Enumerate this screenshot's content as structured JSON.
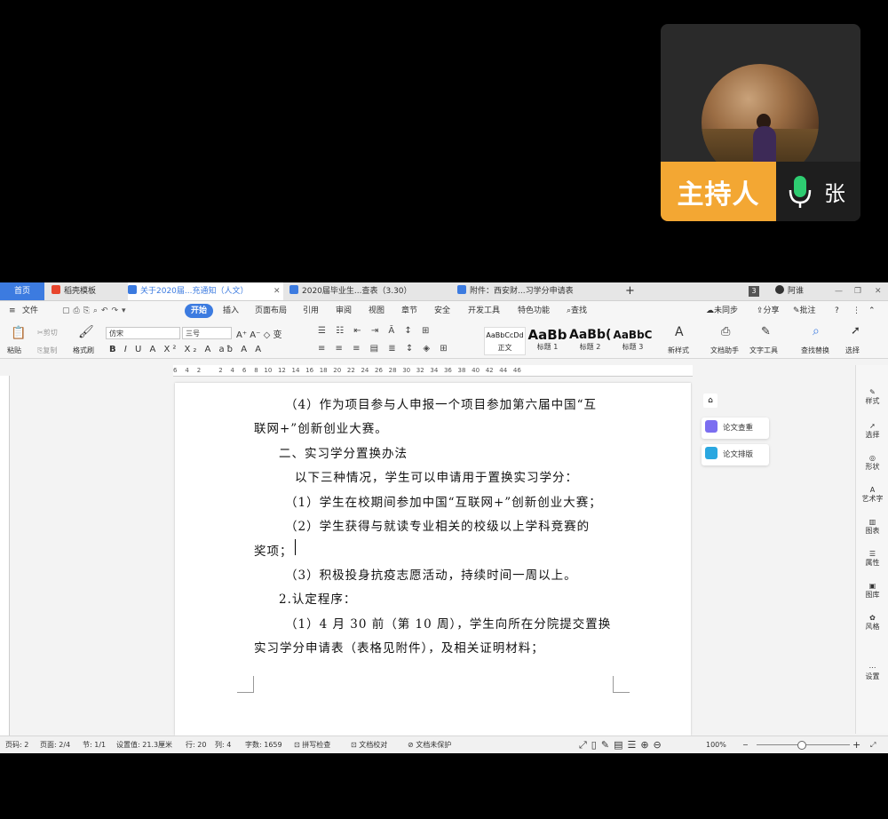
{
  "video": {
    "host_badge": "主持人",
    "participant_name": "张"
  },
  "tabs": {
    "home": "首页",
    "template": "稻壳模板",
    "doc1": "关于2020届...充通知（人文）",
    "doc2": "2020届毕业生...查表（3.30）",
    "doc3": "附件：西安财...习学分申请表",
    "add": "+",
    "page_count": "3",
    "user": "阿谁"
  },
  "menu": {
    "file": "文件",
    "items": [
      "开始",
      "插入",
      "页面布局",
      "引用",
      "审阅",
      "视图",
      "章节",
      "安全",
      "开发工具",
      "特色功能"
    ],
    "search": "查找",
    "sync": "未同步",
    "share": "分享",
    "comment": "批注"
  },
  "ribbon": {
    "paste": "粘贴",
    "cut": "剪切",
    "copy": "复制",
    "format_painter": "格式刷",
    "font_name": "仿宋",
    "font_size": "三号",
    "styles": [
      {
        "preview": "AaBbCcDd",
        "label": "正文"
      },
      {
        "preview": "AaBb",
        "label": "标题 1"
      },
      {
        "preview": "AaBb(",
        "label": "标题 2"
      },
      {
        "preview": "AaBbC",
        "label": "标题 3"
      }
    ],
    "new_style": "新样式",
    "doc_assistant": "文档助手",
    "text_tools": "文字工具",
    "find_replace": "查找替换",
    "select": "选择"
  },
  "ruler_text": "6    4    2         2    4    6    8   10   12   14   16   18   20   22   24   26   28   30   32   34   36   38   40   42   44   46",
  "document": {
    "lines": [
      "（4）作为项目参与人申报一个项目参加第六届中国“互",
      "联网+”创新创业大赛。",
      "二、实习学分置换办法",
      "以下三种情况，学生可以申请用于置换实习学分：",
      "（1）学生在校期间参加中国“互联网+”创新创业大赛；",
      "（2）学生获得与就读专业相关的校级以上学科竞赛的",
      "奖项；",
      "（3）积极投身抗疫志愿活动，持续时间一周以上。",
      "2.认定程序：",
      "（1）4 月 30 前（第 10 周），学生向所在分院提交置换",
      "实习学分申请表（表格见附件），及相关证明材料；"
    ]
  },
  "float_panel": {
    "thesis_check": "论文查重",
    "thesis_format": "论文排版"
  },
  "right_sidebar": [
    "样式",
    "选择",
    "形状",
    "艺术字",
    "图表",
    "属性",
    "图库",
    "风格",
    "设置"
  ],
  "status": {
    "page": "页码: 2",
    "pages": "页面: 2/4",
    "section": "节: 1/1",
    "setting": "设置值: 21.3厘米",
    "row": "行: 20",
    "col": "列: 4",
    "words": "字数: 1659",
    "spell": "拼写检查",
    "proof": "文档校对",
    "protect": "文档未保护",
    "zoom": "100%"
  },
  "colors": {
    "accent": "#3c7be0",
    "host_badge": "#f3a733"
  }
}
